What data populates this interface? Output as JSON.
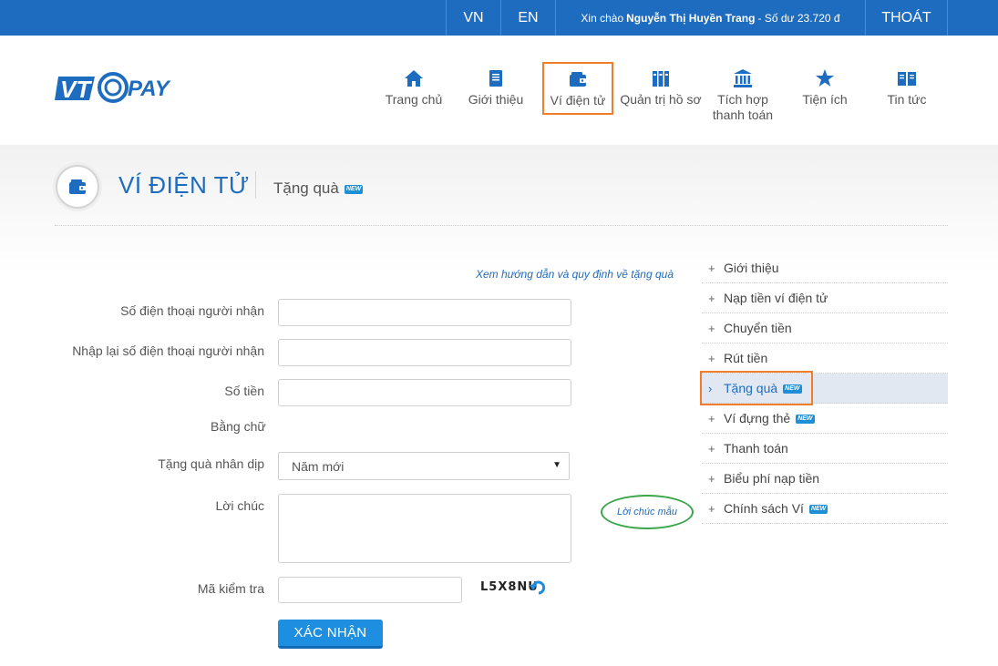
{
  "topbar": {
    "lang_vn": "VN",
    "lang_en": "EN",
    "greeting_prefix": "Xin chào",
    "user_name": "Nguyễn Thị Huyền Trang",
    "balance_text": "- Số dư 23.720 đ",
    "logout": "THOÁT",
    "bg_color": "#1e6cbf"
  },
  "nav": {
    "items": [
      {
        "label": "Trang chủ",
        "icon": "home-icon"
      },
      {
        "label": "Giới thiệu",
        "icon": "book-icon"
      },
      {
        "label": "Ví điện tử",
        "icon": "wallet-icon",
        "active": true
      },
      {
        "label": "Quản trị hồ sơ",
        "icon": "binders-icon"
      },
      {
        "label": "Tích hợp thanh toán",
        "icon": "bank-icon"
      },
      {
        "label": "Tiện ích",
        "icon": "star-icon"
      },
      {
        "label": "Tin tức",
        "icon": "open-book-icon"
      }
    ]
  },
  "page": {
    "title": "VÍ ĐIỆN TỬ",
    "subtitle": "Tặng quà",
    "new_badge": "NEW"
  },
  "form": {
    "guide_link": "Xem hướng dẫn và quy định về tặng quà",
    "phone_label": "Số điện thoại người nhận",
    "phone_confirm_label": "Nhập lại số điện thoại người nhận",
    "amount_label": "Số tiền",
    "amount_words_label": "Bằng chữ",
    "occasion_label": "Tặng quà nhân dịp",
    "occasion_value": "Năm mới",
    "message_label": "Lời chúc",
    "sample_message_link": "Lời chúc mẫu",
    "captcha_label": "Mã kiểm tra",
    "captcha_text": "L5X8NU",
    "submit_label": "XÁC NHẬN"
  },
  "sidebar": {
    "items": [
      {
        "label": "Giới thiệu",
        "marker": "+"
      },
      {
        "label": "Nạp tiền ví điện tử",
        "marker": "+"
      },
      {
        "label": "Chuyển tiền",
        "marker": "+"
      },
      {
        "label": "Rút tiền",
        "marker": "+"
      },
      {
        "label": "Tặng quà",
        "marker": "›",
        "active": true,
        "badge": "NEW"
      },
      {
        "label": "Ví đựng thẻ",
        "marker": "+",
        "badge": "NEW"
      },
      {
        "label": "Thanh toán",
        "marker": "+"
      },
      {
        "label": "Biểu phí nạp tiền",
        "marker": "+"
      },
      {
        "label": "Chính sách Ví",
        "marker": "+",
        "badge": "NEW"
      }
    ]
  },
  "colors": {
    "accent": "#1e6cbf",
    "highlight_border": "#f07d2c",
    "sample_ellipse": "#3aa64a"
  }
}
